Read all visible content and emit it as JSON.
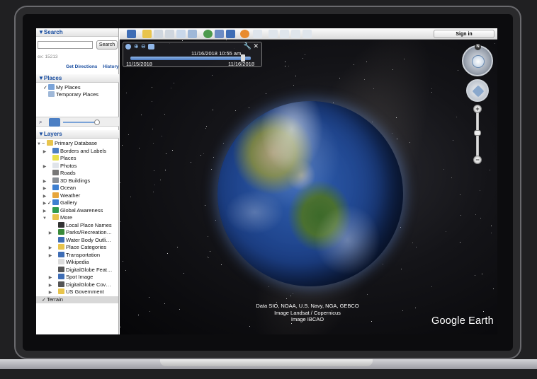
{
  "search": {
    "header": "▼Search",
    "button": "Search",
    "hint": "ex: 15213",
    "links": [
      "Get Directions",
      "History"
    ]
  },
  "places": {
    "header": "▼Places",
    "items": [
      "My Places",
      "Temporary Places"
    ]
  },
  "layers": {
    "header": "▼Layers",
    "items": [
      "Primary Database",
      "Borders and Labels",
      "Places",
      "Photos",
      "Roads",
      "3D Buildings",
      "Ocean",
      "Weather",
      "Gallery",
      "Global Awareness",
      "More",
      "Local Place Names",
      "Parks/Recreation…",
      "Water Body Outli…",
      "Place Categories",
      "Transportation",
      "Wikipedia",
      "DigitalGlobe Feat…",
      "Spot Image",
      "DigitalGlobe Cov…",
      "US Government",
      "Terrain"
    ]
  },
  "toolbar": {
    "signin": "Sign in"
  },
  "timeslider": {
    "current": "11/16/2018  10:55 am",
    "start": "11/15/2018",
    "end": "11/16/2018"
  },
  "nav": {
    "north": "N",
    "zoom_in": "+",
    "zoom_out": "−"
  },
  "credits": [
    "Data SIO, NOAA, U.S. Navy, NGA, GEBCO",
    "Image Landsat / Copernicus",
    "Image IBCAO"
  ],
  "brand": "Google Earth",
  "colors": {
    "section_header": "#1a4ea0",
    "background": "#202022"
  }
}
